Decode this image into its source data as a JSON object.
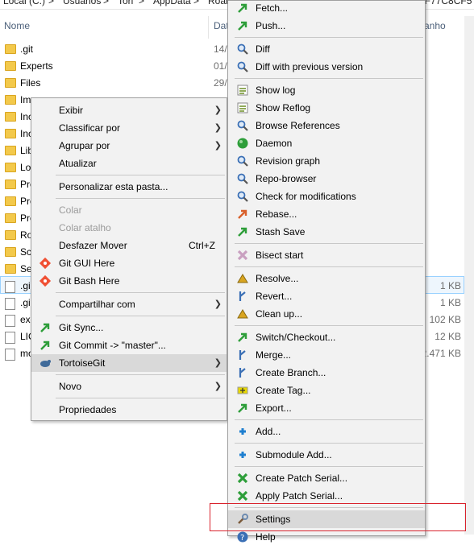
{
  "breadcrumb": {
    "items": [
      "Local (C:)",
      "Usuarios",
      "Tori",
      "AppData",
      "Roam"
    ],
    "right_fragment": "#F77C8CF5"
  },
  "columns": {
    "name": "Nome",
    "date": "Dat",
    "size": "anho"
  },
  "files": [
    {
      "name": ".git",
      "date": "14/",
      "size": "",
      "kind": "folder"
    },
    {
      "name": "Experts",
      "date": "01/",
      "size": "",
      "kind": "folder"
    },
    {
      "name": "Files",
      "date": "29/",
      "size": "",
      "kind": "folder"
    },
    {
      "name": "Im",
      "date": "",
      "size": "",
      "kind": "folder"
    },
    {
      "name": "Inc",
      "date": "",
      "size": "",
      "kind": "folder"
    },
    {
      "name": "Inc",
      "date": "",
      "size": "",
      "kind": "folder"
    },
    {
      "name": "Lib",
      "date": "",
      "size": "",
      "kind": "folder"
    },
    {
      "name": "Lo",
      "date": "",
      "size": "",
      "kind": "folder"
    },
    {
      "name": "Pre",
      "date": "",
      "size": "",
      "kind": "folder"
    },
    {
      "name": "Pre",
      "date": "",
      "size": "",
      "kind": "folder"
    },
    {
      "name": "Pre",
      "date": "",
      "size": "",
      "kind": "folder"
    },
    {
      "name": "Ro",
      "date": "",
      "size": "",
      "kind": "folder"
    },
    {
      "name": "Sc",
      "date": "",
      "size": "",
      "kind": "folder"
    },
    {
      "name": "Se",
      "date": "",
      "size": "",
      "kind": "folder"
    },
    {
      "name": ".gi",
      "date": "",
      "size": "1 KB",
      "kind": "doc"
    },
    {
      "name": ".gi",
      "date": "",
      "size": "1 KB",
      "kind": "doc"
    },
    {
      "name": "exp",
      "date": "",
      "size": "102 KB",
      "kind": "doc"
    },
    {
      "name": "LIC",
      "date": "",
      "size": "12 KB",
      "kind": "doc"
    },
    {
      "name": "mo",
      "date": "",
      "size": "2.471 KB",
      "kind": "doc"
    }
  ],
  "context_menu": {
    "items": [
      {
        "label": "Exibir",
        "submenu": true
      },
      {
        "label": "Classificar por",
        "submenu": true
      },
      {
        "label": "Agrupar por",
        "submenu": true
      },
      {
        "label": "Atualizar"
      },
      {
        "sep": true
      },
      {
        "label": "Personalizar esta pasta..."
      },
      {
        "sep": true
      },
      {
        "label": "Colar",
        "disabled": true
      },
      {
        "label": "Colar atalho",
        "disabled": true
      },
      {
        "label": "Desfazer Mover",
        "shortcut": "Ctrl+Z"
      },
      {
        "label": "Git GUI Here",
        "icon": "git-gui-icon"
      },
      {
        "label": "Git Bash Here",
        "icon": "git-bash-icon"
      },
      {
        "sep": true
      },
      {
        "label": "Compartilhar com",
        "submenu": true
      },
      {
        "sep": true
      },
      {
        "label": "Git Sync...",
        "icon": "git-sync-icon"
      },
      {
        "label": "Git Commit -> \"master\"...",
        "icon": "git-commit-icon"
      },
      {
        "label": "TortoiseGit",
        "icon": "tortoisegit-icon",
        "submenu": true,
        "hover": true
      },
      {
        "sep": true
      },
      {
        "label": "Novo",
        "submenu": true
      },
      {
        "sep": true
      },
      {
        "label": "Propriedades"
      }
    ]
  },
  "tortoise_menu": {
    "items": [
      {
        "label": "Fetch...",
        "icon": "fetch-icon",
        "color": "#2e9e3a"
      },
      {
        "label": "Push...",
        "icon": "push-icon",
        "color": "#2e9e3a"
      },
      {
        "sep": true
      },
      {
        "label": "Diff",
        "icon": "diff-icon",
        "color": "#3a6fb5"
      },
      {
        "label": "Diff with previous version",
        "icon": "diff-previous-icon",
        "color": "#3a6fb5"
      },
      {
        "sep": true
      },
      {
        "label": "Show log",
        "icon": "log-icon",
        "color": "#6b8e23"
      },
      {
        "label": "Show Reflog",
        "icon": "reflog-icon",
        "color": "#6b8e23"
      },
      {
        "label": "Browse References",
        "icon": "browse-references-icon",
        "color": "#3a6fb5"
      },
      {
        "label": "Daemon",
        "icon": "daemon-icon",
        "color": "#2e9e3a"
      },
      {
        "label": "Revision graph",
        "icon": "revision-graph-icon",
        "color": "#3a6fb5"
      },
      {
        "label": "Repo-browser",
        "icon": "repo-browser-icon",
        "color": "#3a6fb5"
      },
      {
        "label": "Check for modifications",
        "icon": "check-modifications-icon",
        "color": "#3a6fb5"
      },
      {
        "label": "Rebase...",
        "icon": "rebase-icon",
        "color": "#d9602b"
      },
      {
        "label": "Stash Save",
        "icon": "stash-save-icon",
        "color": "#2e9e3a"
      },
      {
        "sep": true
      },
      {
        "label": "Bisect start",
        "icon": "bisect-icon",
        "color": "#c9a0c0"
      },
      {
        "sep": true
      },
      {
        "label": "Resolve...",
        "icon": "resolve-icon",
        "color": "#d9a520"
      },
      {
        "label": "Revert...",
        "icon": "revert-icon",
        "color": "#3a6fb5"
      },
      {
        "label": "Clean up...",
        "icon": "cleanup-icon",
        "color": "#d9a520"
      },
      {
        "sep": true
      },
      {
        "label": "Switch/Checkout...",
        "icon": "switch-checkout-icon",
        "color": "#2e9e3a"
      },
      {
        "label": "Merge...",
        "icon": "merge-icon",
        "color": "#3a6fb5"
      },
      {
        "label": "Create Branch...",
        "icon": "create-branch-icon",
        "color": "#3a6fb5"
      },
      {
        "label": "Create Tag...",
        "icon": "create-tag-icon",
        "color": "#e8d800"
      },
      {
        "label": "Export...",
        "icon": "export-icon",
        "color": "#2e9e3a"
      },
      {
        "sep": true
      },
      {
        "label": "Add...",
        "icon": "add-icon",
        "color": "#1e7fd0"
      },
      {
        "sep": true
      },
      {
        "label": "Submodule Add...",
        "icon": "submodule-add-icon",
        "color": "#1e7fd0"
      },
      {
        "sep": true
      },
      {
        "label": "Create Patch Serial...",
        "icon": "create-patch-icon",
        "color": "#2e9e3a"
      },
      {
        "label": "Apply Patch Serial...",
        "icon": "apply-patch-icon",
        "color": "#2e9e3a"
      },
      {
        "sep": true
      },
      {
        "label": "Settings",
        "icon": "settings-icon",
        "color": "#7a5a3a",
        "hover": true
      },
      {
        "label": "Help",
        "icon": "help-icon",
        "color": "#3a6fb5"
      }
    ]
  }
}
